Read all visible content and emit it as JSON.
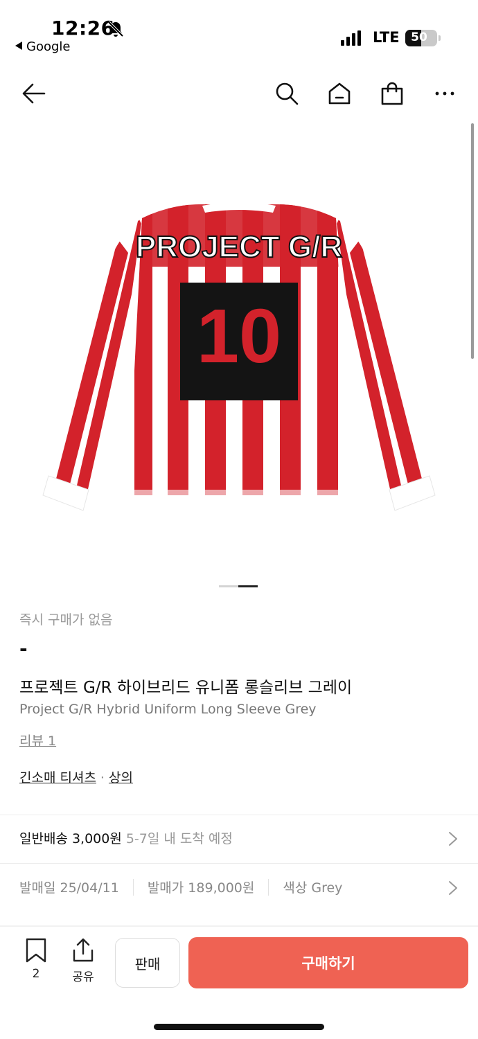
{
  "status_bar": {
    "time": "12:26",
    "back_app": "Google",
    "network": "LTE",
    "battery": "50"
  },
  "navbar": {
    "icons": [
      "back-arrow-icon",
      "search-icon",
      "home-icon",
      "shopping-bag-icon",
      "more-icon"
    ]
  },
  "product_image": {
    "jersey_brand_text": "PROJECT G/R",
    "jersey_number": "10",
    "colors": {
      "red": "#d3222b",
      "white": "#ffffff",
      "patch": "#141414"
    },
    "pager_total": 2,
    "pager_active": 2
  },
  "product": {
    "instant_buy_note": "즉시 구매가 없음",
    "price": "-",
    "title_ko": "프로젝트 G/R 하이브리드 유니폼 롱슬리브 그레이",
    "title_en": "Project G/R Hybrid Uniform Long Sleeve Grey",
    "review": "리뷰 1",
    "category_1": "긴소매 티셔츠",
    "category_sep": "·",
    "category_2": "상의"
  },
  "shipping": {
    "label": "일반배송 3,000원",
    "estimate": "5-7일 내 도착 예정"
  },
  "meta": {
    "release_date": "발매일 25/04/11",
    "release_price": "발매가 189,000원",
    "color": "색상 Grey"
  },
  "bottom_bar": {
    "bookmark_count": "2",
    "share_label": "공유",
    "sell_label": "판매",
    "buy_label": "구매하기",
    "buy_color": "#ef6253"
  }
}
